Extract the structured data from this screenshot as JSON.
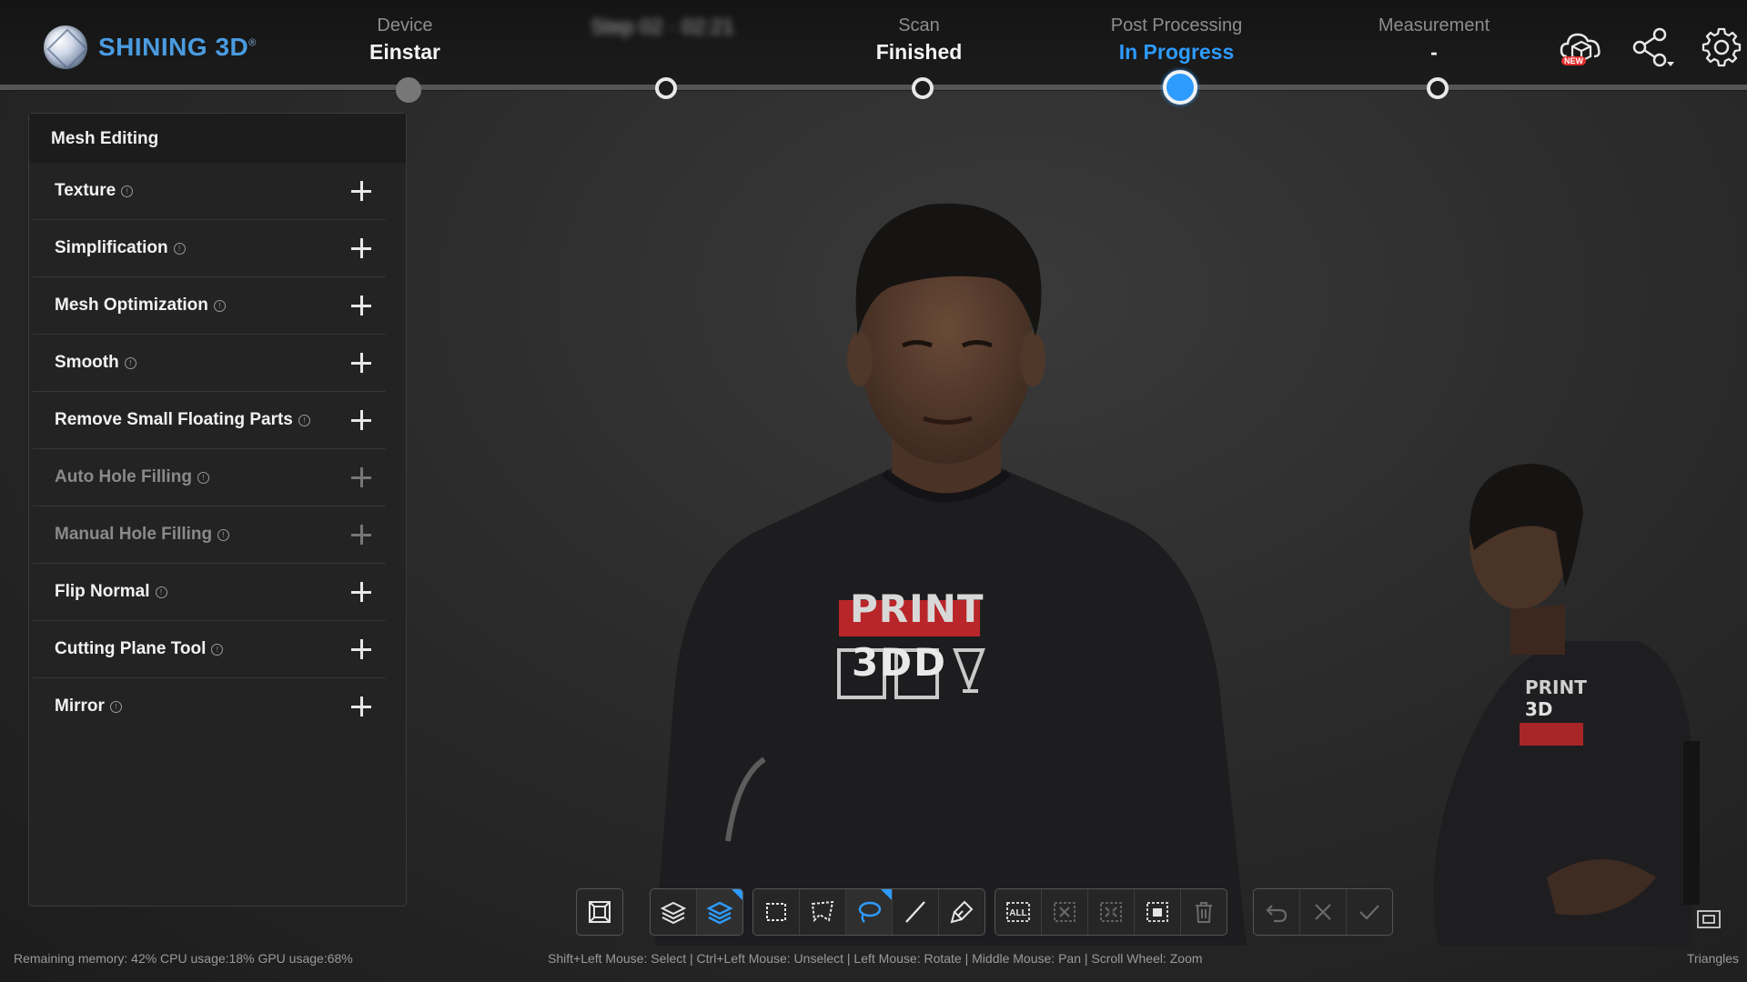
{
  "app": {
    "brand": "SHINING 3D",
    "brand_mark": "®"
  },
  "steps": [
    {
      "label": "Device",
      "value": "Einstar"
    },
    {
      "label": "",
      "value": "Step 02 · 02:21"
    },
    {
      "label": "Scan",
      "value": "Finished"
    },
    {
      "label": "Post Processing",
      "value": "In Progress"
    },
    {
      "label": "Measurement",
      "value": "-"
    }
  ],
  "top_icons": {
    "new_badge": "NEW"
  },
  "panel": {
    "title": "Mesh Editing",
    "items": [
      {
        "label": "Texture",
        "enabled": true
      },
      {
        "label": "Simplification",
        "enabled": true
      },
      {
        "label": "Mesh Optimization",
        "enabled": true
      },
      {
        "label": "Smooth",
        "enabled": true
      },
      {
        "label": "Remove Small Floating Parts",
        "enabled": true
      },
      {
        "label": "Auto Hole Filling",
        "enabled": false
      },
      {
        "label": "Manual Hole Filling",
        "enabled": false
      },
      {
        "label": "Flip Normal",
        "enabled": true
      },
      {
        "label": "Cutting Plane Tool",
        "enabled": true
      },
      {
        "label": "Mirror",
        "enabled": true
      }
    ]
  },
  "viewport": {
    "shirt_line1": "PRINT",
    "shirt_line2": "3DD",
    "side_shirt_line1": "PRINT",
    "side_shirt_line2": "3D"
  },
  "toolbar": {
    "select_all_label": "ALL"
  },
  "status": {
    "resources": "Remaining memory: 42%  CPU usage:18%  GPU usage:68%",
    "hint": "Shift+Left Mouse: Select | Ctrl+Left Mouse: Unselect | Left Mouse: Rotate | Middle Mouse: Pan | Scroll Wheel: Zoom",
    "triangles": "Triangles"
  },
  "colors": {
    "accent": "#2e9bff",
    "brand": "#4a9be0",
    "panel": "#232323"
  }
}
